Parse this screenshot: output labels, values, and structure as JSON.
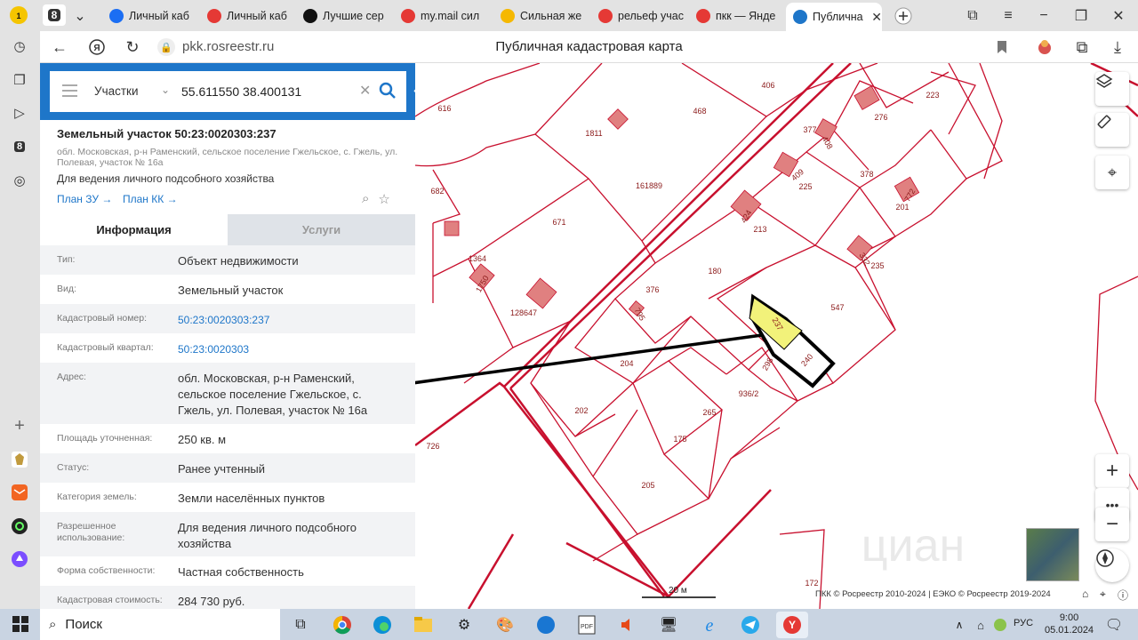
{
  "browser": {
    "tab_count": "8",
    "tabs": [
      {
        "label": "Личный каб",
        "icon": "arrow-icon",
        "color": "#1b6ef3"
      },
      {
        "label": "Личный каб",
        "icon": "red-circle-icon",
        "color": "#e53935"
      },
      {
        "label": "Лучшие сер",
        "icon": "f-icon",
        "color": "#111111"
      },
      {
        "label": "my.mail сил",
        "icon": "yandex-icon",
        "color": "#e53935"
      },
      {
        "label": "Сильная же",
        "icon": "play-icon",
        "color": "#f5b800"
      },
      {
        "label": "рельеф учас",
        "icon": "yandex-icon",
        "color": "#e53935"
      },
      {
        "label": "пкк — Янде",
        "icon": "yandex-icon",
        "color": "#e53935"
      },
      {
        "label": "Публична",
        "icon": "rosreestr-icon",
        "color": "#1e76c9"
      }
    ],
    "address_host": "pkk.rosreestr.ru",
    "page_title": "Публичная кадастровая карта"
  },
  "search": {
    "type": "Участки",
    "value": "55.611550 38.400131"
  },
  "object": {
    "title": "Земельный участок 50:23:0020303:237",
    "address_small": "обл. Московская, р-н Раменский, сельское поселение Гжельское, с. Гжель, ул. Полевая, участок № 16а",
    "use": "Для ведения личного подсобного хозяйства",
    "plan_zu": "План ЗУ →",
    "plan_kk": "План КК →"
  },
  "tabs": {
    "info": "Информация",
    "services": "Услуги"
  },
  "info_rows": [
    {
      "key": "Тип:",
      "value": "Объект недвижимости",
      "link": false,
      "h": 33
    },
    {
      "key": "Вид:",
      "value": "Земельный участок",
      "link": false,
      "h": 33
    },
    {
      "key": "Кадастровый номер:",
      "value": "50:23:0020303:237",
      "link": true,
      "h": 33
    },
    {
      "key": "Кадастровый квартал:",
      "value": "50:23:0020303",
      "link": true,
      "h": 33
    },
    {
      "key": "Адрес:",
      "value": "обл. Московская, р-н Раменский, сельское поселение Гжельское, с. Гжель, ул. Полевая, участок № 16а",
      "link": false,
      "h": 69
    },
    {
      "key": "Площадь уточненная:",
      "value": "250 кв. м",
      "link": false,
      "h": 33
    },
    {
      "key": "Статус:",
      "value": "Ранее учтенный",
      "link": false,
      "h": 33
    },
    {
      "key": "Категория земель:",
      "value": "Земли населённых пунктов",
      "link": false,
      "h": 33
    },
    {
      "key": "Разрешенное использование:",
      "value": "Для ведения личного подсобного хозяйства",
      "link": false,
      "h": 50
    },
    {
      "key": "Форма собственности:",
      "value": "Частная собственность",
      "link": false,
      "h": 33
    },
    {
      "key": "Кадастровая стоимость:",
      "value": "284 730 руб.",
      "link": false,
      "h": 33
    }
  ],
  "map": {
    "parcel_labels": [
      "616",
      "406",
      "223",
      "468",
      "1811",
      "276",
      "377",
      "408",
      "378",
      "161889",
      "225",
      "409",
      "682",
      "772",
      "201",
      "671",
      "424",
      "213",
      "1364",
      "332",
      "235",
      "180",
      "1750",
      "128647",
      "376",
      "547",
      "795",
      "237",
      "240",
      "204",
      "298",
      "936/2",
      "202",
      "265",
      "175",
      "726",
      "205",
      "172"
    ],
    "scale": "20 м",
    "copyright": "ПКК © Росреестр 2010-2024 | ЕЭКО © Росреестр 2019-2024",
    "watermark": "циан"
  },
  "taskbar": {
    "search_placeholder": "Поиск",
    "lang": "РУС",
    "time": "9:00",
    "date": "05.01.2024"
  }
}
